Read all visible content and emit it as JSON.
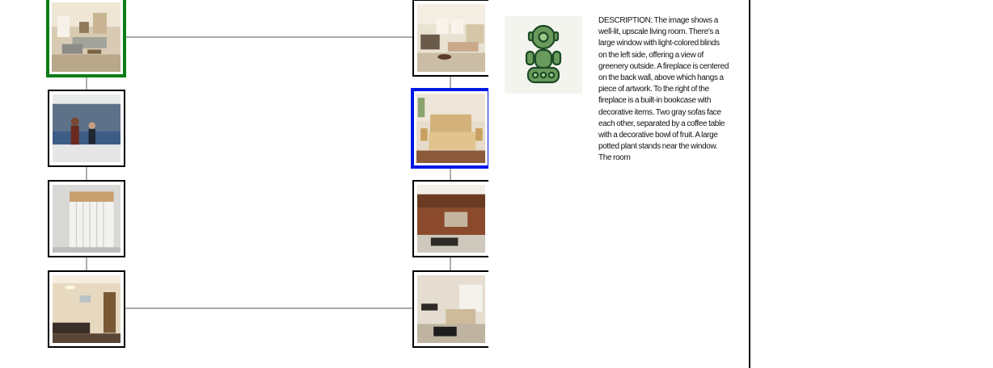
{
  "left_column": [
    {
      "id": "L1",
      "scene": "living-room",
      "selected": "green"
    },
    {
      "id": "L2",
      "scene": "room-occupants",
      "selected": "none"
    },
    {
      "id": "L3",
      "scene": "closet-door",
      "selected": "none"
    },
    {
      "id": "L4",
      "scene": "living-room-lamp",
      "selected": "none"
    }
  ],
  "right_column": [
    {
      "id": "R1",
      "scene": "living-room-bright",
      "selected": "none"
    },
    {
      "id": "R2",
      "scene": "bedroom",
      "selected": "blue"
    },
    {
      "id": "R3",
      "scene": "kitchen-bar",
      "selected": "none"
    },
    {
      "id": "R4",
      "scene": "sitting-room",
      "selected": "none"
    }
  ],
  "avatar": {
    "icon": "robot-icon",
    "color": "#6a9a5c"
  },
  "description": {
    "text": "DESCRIPTION: The image shows a well-lit, upscale living room. There's a large window with light-colored blinds on the left side, offering a view of greenery outside. A fireplace is centered on the back wall, above which hangs a piece of artwork. To the right of the fireplace is a built-in bookcase with decorative items. Two gray sofas face each other, separated by a coffee table with a decorative bowl of fruit. A large potted plant stands near the window. The room"
  },
  "colors": {
    "selected_green": "#0a7d17",
    "selected_blue": "#0018e6",
    "connector": "#777777"
  }
}
